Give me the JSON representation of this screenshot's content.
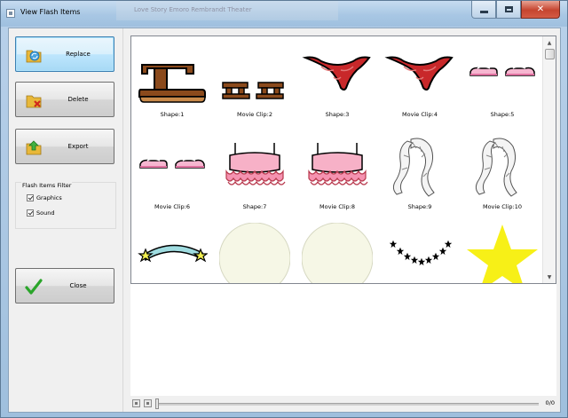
{
  "window": {
    "title": "View Flash Items",
    "background_tab": "Love Story Emoro Rembrandt Theater",
    "colors": {
      "accent": "#3c7fb1",
      "close": "#c6452f"
    }
  },
  "left_panel": {
    "replace_label": "Replace",
    "delete_label": "Delete",
    "export_label": "Export",
    "close_label": "Close",
    "filter": {
      "title": "Flash Items Filter",
      "graphics_label": "Graphics",
      "sound_label": "Sound",
      "graphics_checked": true,
      "sound_checked": true
    }
  },
  "gallery": {
    "items": [
      {
        "caption": "Shape:1",
        "icon": "sandal-brown-icon"
      },
      {
        "caption": "Movie Clip:2",
        "icon": "sandals-small-icon"
      },
      {
        "caption": "Shape:3",
        "icon": "red-bandana-icon"
      },
      {
        "caption": "Movie Clip:4",
        "icon": "red-bandana-icon"
      },
      {
        "caption": "Shape:5",
        "icon": "pink-shoes-icon"
      },
      {
        "caption": "Movie Clip:6",
        "icon": "pink-shoes-icon"
      },
      {
        "caption": "Shape:7",
        "icon": "pink-top-icon"
      },
      {
        "caption": "Movie Clip:8",
        "icon": "pink-top-icon"
      },
      {
        "caption": "Shape:9",
        "icon": "feather-boa-icon"
      },
      {
        "caption": "Movie Clip:10",
        "icon": "feather-boa-icon"
      },
      {
        "caption": "",
        "icon": "star-wand-icon"
      },
      {
        "caption": "",
        "icon": "pale-circle-icon"
      },
      {
        "caption": "",
        "icon": "pale-circle-icon"
      },
      {
        "caption": "",
        "icon": "star-chain-icon"
      },
      {
        "caption": "",
        "icon": "yellow-star-icon"
      }
    ]
  },
  "footer": {
    "counter": "0/0"
  }
}
